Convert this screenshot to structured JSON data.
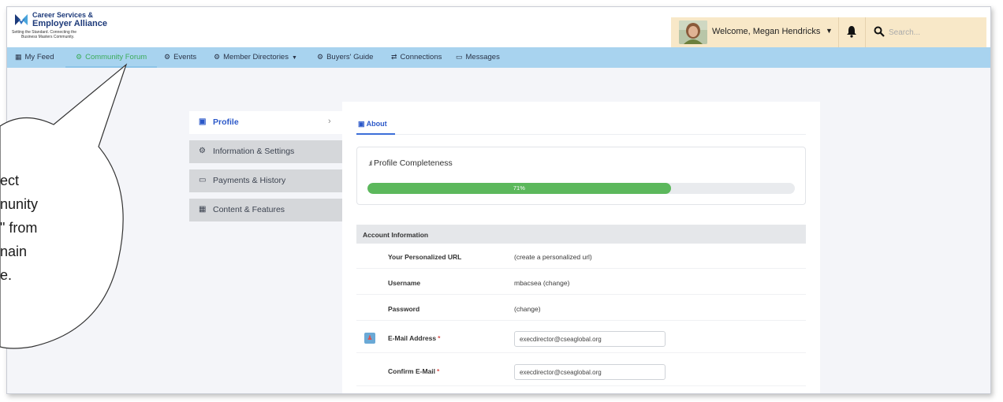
{
  "header": {
    "logo_line1": "Career Services &",
    "logo_line2": "Employer Alliance",
    "logo_tag1": "Setting the Standard. Connecting the",
    "logo_tag2": "Business Masters Community.",
    "welcome": "Welcome, Megan Hendricks",
    "search_placeholder": "Search..."
  },
  "nav": {
    "items": [
      {
        "label": "My Feed",
        "icon": "news-icon"
      },
      {
        "label": "Community Forum",
        "icon": "cogs-icon",
        "active": true
      },
      {
        "label": "Events",
        "icon": "cogs-icon"
      },
      {
        "label": "Member Directories",
        "icon": "cogs-icon"
      },
      {
        "label": "Buyers' Guide",
        "icon": "cogs-icon"
      },
      {
        "label": "Connections",
        "icon": "connections-icon"
      },
      {
        "label": "Messages",
        "icon": "inbox-icon"
      }
    ]
  },
  "sidebar": {
    "items": [
      {
        "label": "Profile",
        "icon": "profile-icon",
        "active": true
      },
      {
        "label": "Information & Settings",
        "icon": "cogs-icon"
      },
      {
        "label": "Payments & History",
        "icon": "money-icon"
      },
      {
        "label": "Content & Features",
        "icon": "table-icon"
      }
    ]
  },
  "main": {
    "tab_label": "About",
    "completeness_title": "Profile Completeness",
    "completeness_percent": 71,
    "completeness_label": "71%",
    "account_heading": "Account Information",
    "fields": [
      {
        "label": "Your Personalized URL",
        "value": "(create a personalized url)"
      },
      {
        "label": "Username",
        "value": "mbacsea (change)"
      },
      {
        "label": "Password",
        "value": "(change)"
      },
      {
        "label": "E-Mail Address",
        "value": "execdirector@cseaglobal.org"
      },
      {
        "label": "Confirm E-Mail",
        "value": "execdirector@cseaglobal.org"
      }
    ]
  },
  "callout": {
    "line1": "ect",
    "line2": "nunity",
    "line3": "\" from",
    "line4": "nain",
    "line5": "e."
  },
  "colors": {
    "nav_bg": "#a8d3ef",
    "active_green": "#3cab5a",
    "link_blue": "#2b58c9",
    "progress_green": "#5cb85c"
  }
}
